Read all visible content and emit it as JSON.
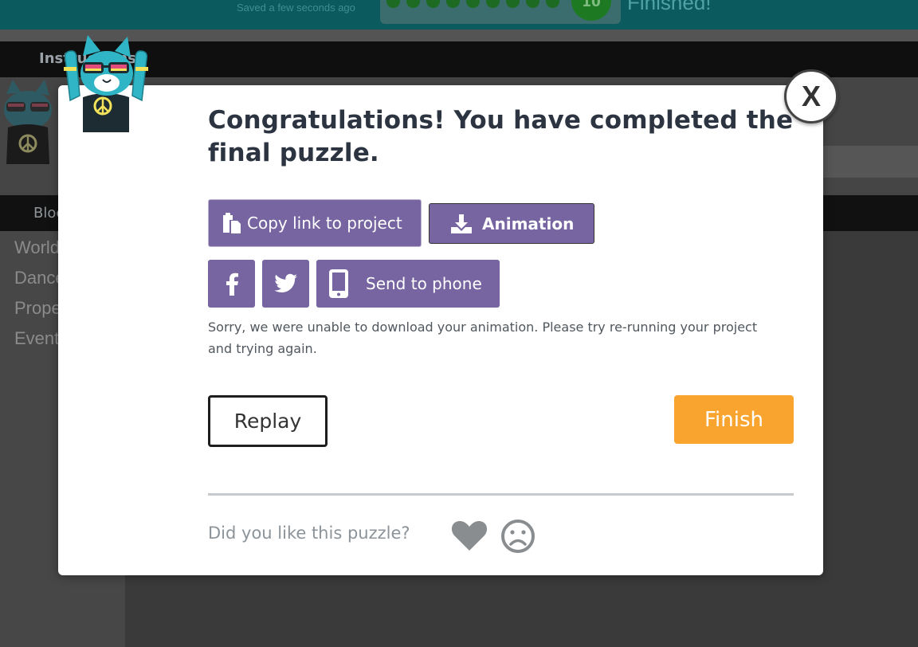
{
  "background": {
    "save_status": "Saved a few seconds ago",
    "current_level": "10",
    "finished_label": "Finished!",
    "instructions_tab": "Instructions",
    "blocks_tab": "Blocks",
    "toolbox_categories": [
      "World",
      "Dancers",
      "Properties",
      "Events"
    ]
  },
  "dialog": {
    "close_label": "X",
    "title": "Congratulations! You have completed the final puzzle.",
    "copy_link_label": "Copy link to project",
    "animation_label": "Animation",
    "send_to_phone_label": "Send to phone",
    "error_message": "Sorry, we were unable to download your animation. Please try re-running your project and trying again.",
    "replay_label": "Replay",
    "finish_label": "Finish",
    "feedback_prompt": "Did you like this puzzle?"
  },
  "icons": [
    "clipboard-icon",
    "download-icon",
    "facebook-icon",
    "twitter-icon",
    "phone-icon",
    "heart-icon",
    "frown-icon"
  ],
  "colors": {
    "button_purple": "#7665a0",
    "finish_orange": "#f9a42f",
    "title_text": "#2b3440"
  }
}
